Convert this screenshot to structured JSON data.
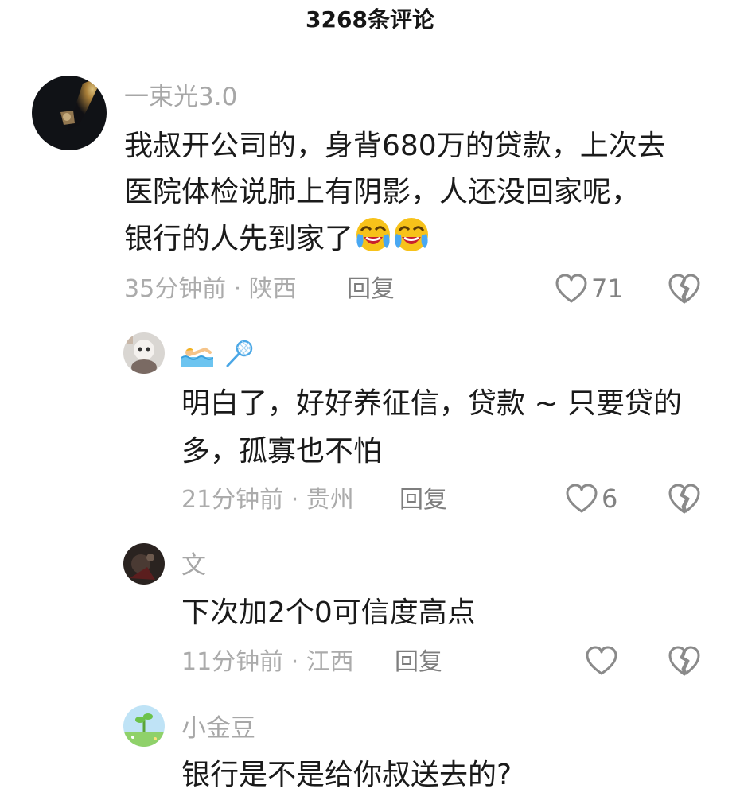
{
  "header": {
    "title": "3268条评论"
  },
  "comments": [
    {
      "username": "一束光3.0",
      "lines": [
        "我叔开公司的，身背680万的贷款，上次去",
        "医院体检说肺上有阴影，人还没回家呢，",
        "银行的人先到家了"
      ],
      "emojis": [
        "laughing-crying-emoji",
        "laughing-crying-emoji"
      ],
      "time": "35分钟前",
      "location": "陕西",
      "meta_sep": " · ",
      "reply_label": "回复",
      "likes": "71"
    },
    {
      "username_icons": [
        "swimmer-emoji",
        "badminton-emoji"
      ],
      "lines": [
        "明白了，好好养征信，贷款 ~ 只要贷的",
        "多，孤寡也不怕"
      ],
      "time": "21分钟前",
      "location": "贵州",
      "meta_sep": " · ",
      "reply_label": "回复",
      "likes": "6"
    },
    {
      "username": "文",
      "lines": [
        "下次加2个0可信度高点"
      ],
      "time": "11分钟前",
      "location": "江西",
      "meta_sep": " · ",
      "reply_label": "回复",
      "likes": ""
    },
    {
      "username": "小金豆",
      "lines": [
        "银行是不是给你叔送去的?"
      ]
    }
  ],
  "colors": {
    "text": "#1a1a1a",
    "secondary": "#a7a7a7",
    "icon": "#8a8a8a"
  }
}
